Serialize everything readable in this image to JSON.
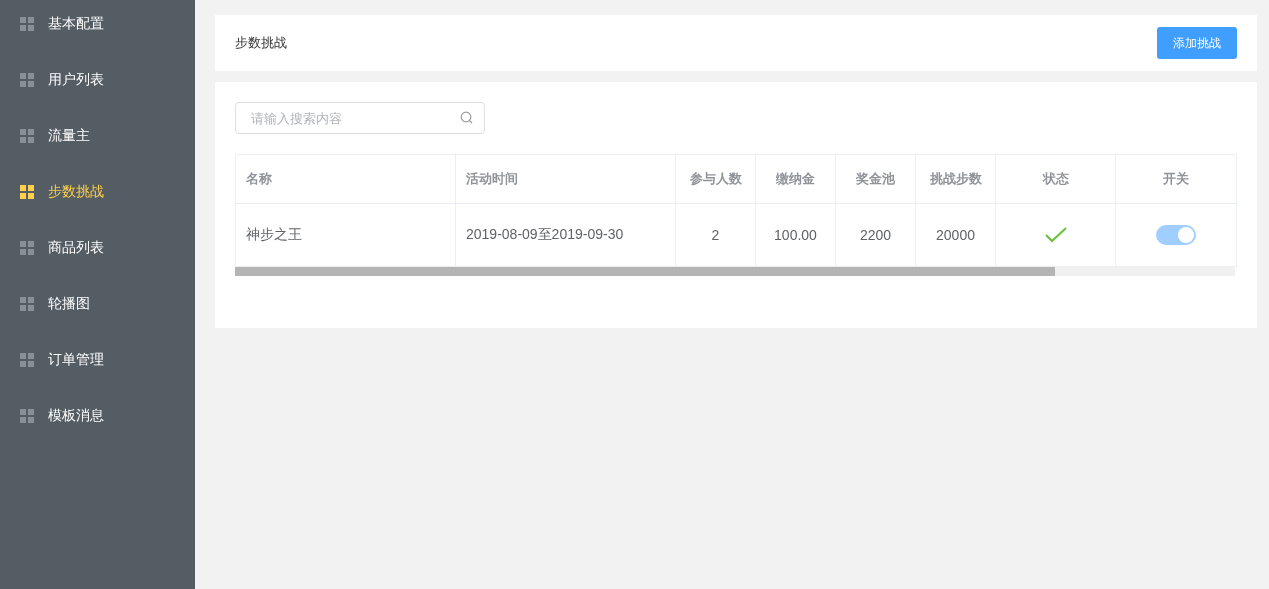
{
  "sidebar": {
    "items": [
      {
        "label": "基本配置",
        "selected": false
      },
      {
        "label": "用户列表",
        "selected": false
      },
      {
        "label": "流量主",
        "selected": false
      },
      {
        "label": "步数挑战",
        "selected": true
      },
      {
        "label": "商品列表",
        "selected": false
      },
      {
        "label": "轮播图",
        "selected": false
      },
      {
        "label": "订单管理",
        "selected": false
      },
      {
        "label": "模板消息",
        "selected": false
      }
    ]
  },
  "header": {
    "title": "步数挑战",
    "button": "添加挑战"
  },
  "search": {
    "placeholder": "请输入搜索内容"
  },
  "table": {
    "columns": [
      "名称",
      "活动时间",
      "参与人数",
      "缴纳金",
      "奖金池",
      "挑战步数",
      "状态",
      "开关"
    ],
    "rows": [
      {
        "name": "神步之王",
        "time": "2019-08-09至2019-09-30",
        "participants": "2",
        "deposit": "100.00",
        "pool": "2200",
        "steps": "20000",
        "status_ok": true,
        "on": true
      }
    ]
  }
}
